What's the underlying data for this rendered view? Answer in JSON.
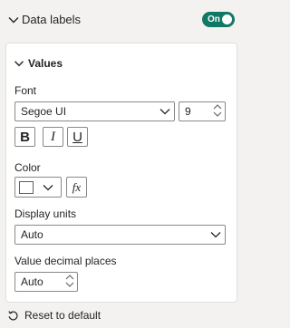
{
  "data_labels": {
    "title": "Data labels",
    "toggle_label": "On",
    "accent_color": "#117865"
  },
  "values_card": {
    "title": "Values",
    "font": {
      "label": "Font",
      "family_value": "Segoe UI",
      "size_value": "9",
      "bold_label": "B",
      "italic_label": "I",
      "underline_label": "U"
    },
    "color": {
      "label": "Color",
      "swatch_color": "#ffffff",
      "fx_label": "fx"
    },
    "display_units": {
      "label": "Display units",
      "value": "Auto"
    },
    "decimal_places": {
      "label": "Value decimal places",
      "value": "Auto"
    }
  },
  "reset": {
    "label": "Reset to default"
  }
}
